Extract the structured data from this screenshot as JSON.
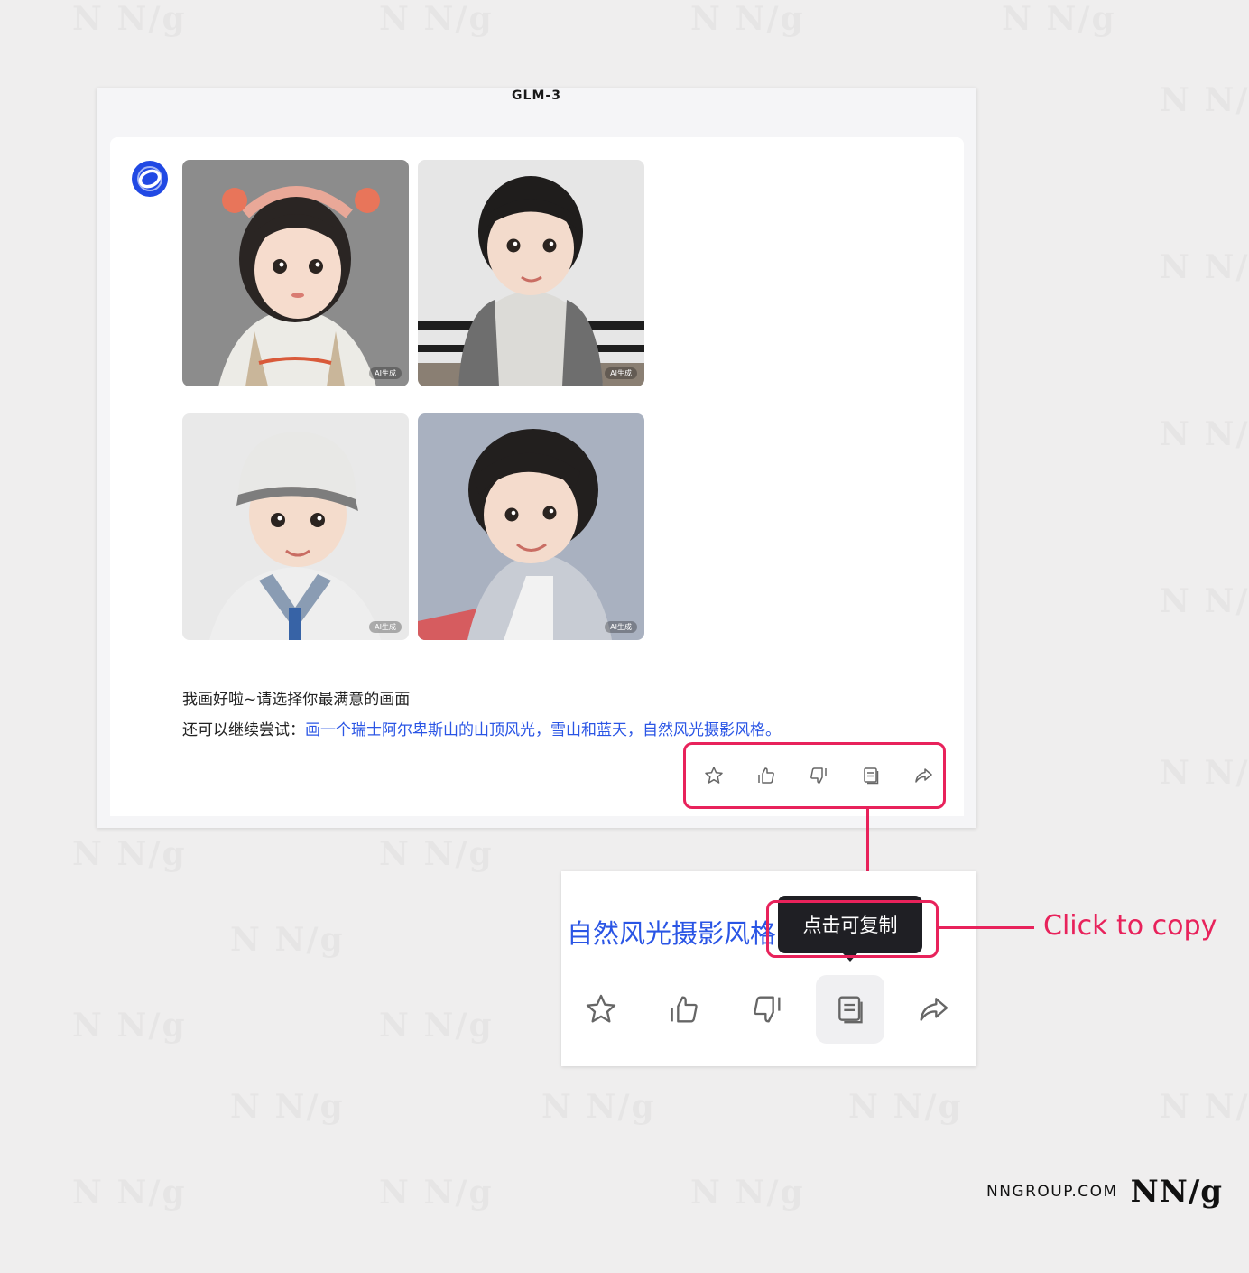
{
  "app": {
    "model_title": "GLM-3"
  },
  "chat": {
    "images": [
      {
        "alt": "girl-portrait",
        "badge": "AI生成"
      },
      {
        "alt": "boy-portrait",
        "badge": "AI生成"
      },
      {
        "alt": "boy-cap-portrait",
        "badge": "AI生成"
      },
      {
        "alt": "boy-smile-portrait",
        "badge": "AI生成"
      }
    ],
    "reply_line1": "我画好啦~请选择你最满意的画面",
    "reply_line2_prefix": "还可以继续尝试：",
    "reply_suggestion": "画一个瑞士阿尔卑斯山的山顶风光，雪山和蓝天，自然风光摄影风格。",
    "actions": [
      {
        "name": "favorite",
        "icon": "star-icon"
      },
      {
        "name": "like",
        "icon": "thumbs-up-icon"
      },
      {
        "name": "dislike",
        "icon": "thumbs-down-icon"
      },
      {
        "name": "copy",
        "icon": "copy-icon"
      },
      {
        "name": "share",
        "icon": "share-icon"
      }
    ]
  },
  "zoom": {
    "text": "自然风光摄影风格",
    "tooltip": "点击可复制"
  },
  "annotation": {
    "label": "Click to copy",
    "color": "#e8225b"
  },
  "footer": {
    "site": "NNGROUP.COM",
    "logo": "NN/g"
  },
  "colors": {
    "accent": "#e8225b",
    "link": "#2a55e5",
    "avatar": "#2149e4"
  }
}
